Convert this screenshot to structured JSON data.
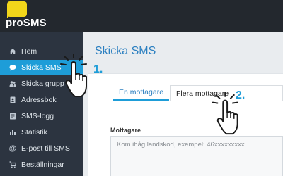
{
  "app": {
    "logo_text": "proSMS",
    "brand_color": "#f2d61a",
    "accent_color": "#1e9dd8"
  },
  "sidebar": {
    "items": [
      {
        "label": "Hem",
        "icon": "home-icon",
        "active": false
      },
      {
        "label": "Skicka SMS",
        "icon": "chat-icon",
        "active": true
      },
      {
        "label": "Skicka grupp SMS",
        "icon": "users-icon",
        "active": false
      },
      {
        "label": "Adressbok",
        "icon": "address-book-icon",
        "active": false
      },
      {
        "label": "SMS-logg",
        "icon": "log-icon",
        "active": false
      },
      {
        "label": "Statistik",
        "icon": "chart-icon",
        "active": false
      },
      {
        "label": "E-post till SMS",
        "icon": "at-icon",
        "active": false
      },
      {
        "label": "Beställningar",
        "icon": "cart-icon",
        "active": false
      }
    ]
  },
  "main": {
    "title": "Skicka SMS",
    "tabs": [
      {
        "label": "En mottagare",
        "active": true
      },
      {
        "label": "Flera mottagare",
        "active": false
      }
    ],
    "recipient_label": "Mottagare",
    "recipient_placeholder": "Kom ihåg landskod, exempel: 46xxxxxxxxx"
  },
  "annotations": {
    "step1": "1.",
    "step2": "2."
  }
}
